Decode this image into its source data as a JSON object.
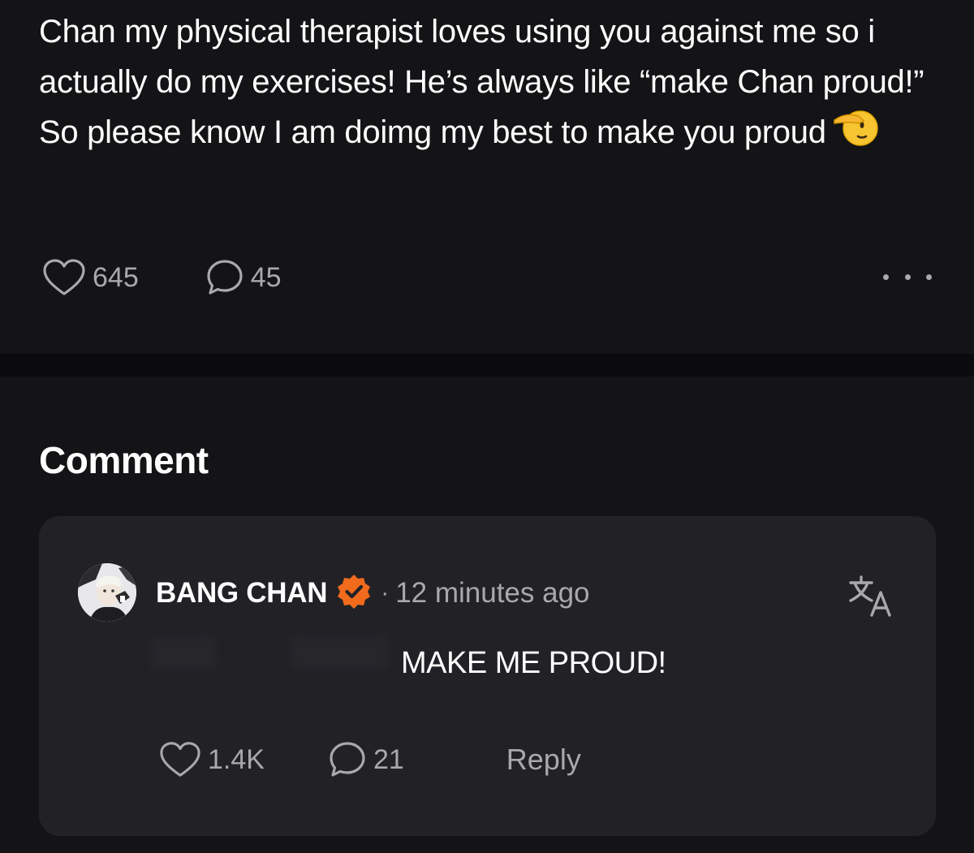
{
  "post": {
    "text": "Chan my physical therapist loves using you against me so i actually do my exercises! He’s always like “make Chan proud!” So please know I am doimg my best to make you proud",
    "emoji": "saluting-face-emoji",
    "likes": "645",
    "comments": "45",
    "more_icon": "more-horizontal-icon"
  },
  "section": {
    "title": "Comment"
  },
  "comment": {
    "author": "BANG CHAN",
    "verified_icon": "verified-badge-icon",
    "separator": "·",
    "time": "12 minutes ago",
    "translate_icon": "translate-icon",
    "text": "MAKE ME PROUD!",
    "likes": "1.4K",
    "replies": "21",
    "reply_label": "Reply"
  },
  "colors": {
    "background": "#141417",
    "divider": "#0b0b0d",
    "card": "#222226",
    "muted_text": "#a9a9ad",
    "verified": "#f26b1d"
  }
}
